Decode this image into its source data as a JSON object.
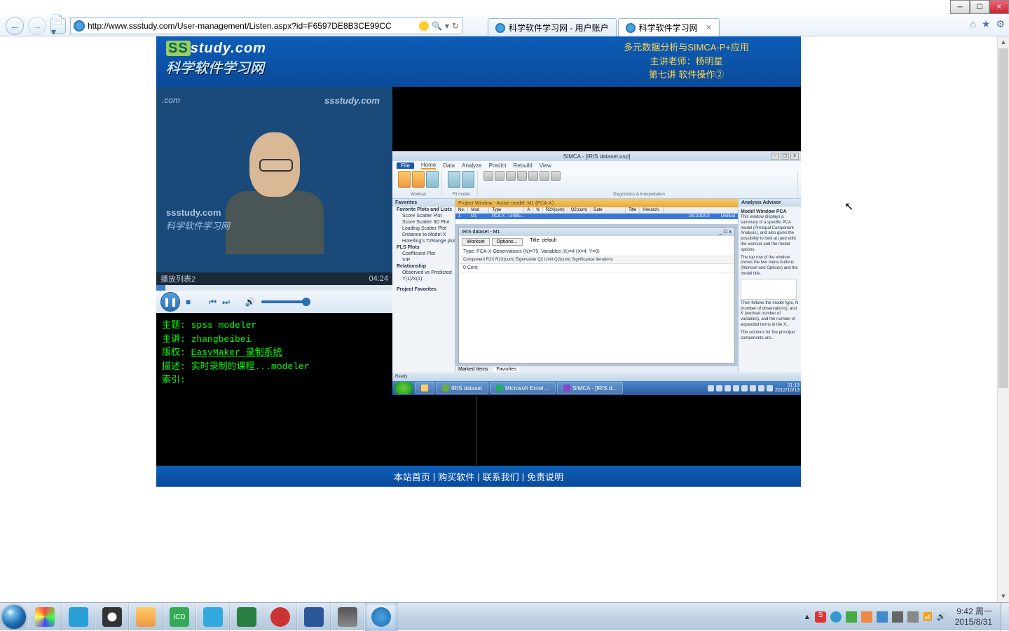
{
  "window": {
    "title": "科学软件学习网 - 用户账户"
  },
  "browser": {
    "url": "http://www.ssstudy.com/User-management/Listen.aspx?id=F6597DE8B3CE99CC",
    "tabs": [
      {
        "label": "科学软件学习网 - 用户账户",
        "active": false
      },
      {
        "label": "科学软件学习网",
        "active": true
      }
    ]
  },
  "header": {
    "logo_en": "study.com",
    "logo_cn": "科学软件学习网",
    "line1": "多元数据分析与SIMCA-P+应用",
    "line2": "主讲老师：杨明星",
    "line3": "第七讲 软件操作②"
  },
  "video": {
    "playlist_label": "播放列表2",
    "time": "04:24",
    "watermarks": {
      "w1": "ssstudy.com",
      "w2": "ssstudy.com",
      "w3": "科学软件学习网",
      "w4": ".com"
    }
  },
  "info": {
    "topic_label": "主题:",
    "topic": "spss modeler",
    "lecturer_label": "主讲:",
    "lecturer": "zhangbeibei",
    "copyright_label": "版权:",
    "copyright": "EasyMaker 录制系统",
    "desc_label": "描述:",
    "desc": "实时录制的课程...modeler",
    "index_label": "索引:"
  },
  "simca": {
    "title": "SIMCA - [IRIS dataset.usp]",
    "menu": [
      "File",
      "Home",
      "Data",
      "Analyze",
      "Predict",
      "Rebuild",
      "View"
    ],
    "ribbon_groups": [
      "Workset",
      "Fit model",
      "Diagnostics & Interpretation"
    ],
    "left_panel": {
      "title": "Favorites",
      "section1": "Favorite Plots and Lists",
      "items1": [
        "Score Scatter Plot",
        "Score Scatter 3D Plot",
        "Loading Scatter Plot",
        "Distance to Model X",
        "Hotelling's T2Range plot"
      ],
      "section2": "PLS Plots",
      "items2": [
        "Coefficient Plot",
        "VIP"
      ],
      "section3": "Relationship",
      "items3": [
        "Observed vs Predicted",
        "Y(1)/X(1)"
      ],
      "section4": "Project Favorites"
    },
    "project": {
      "header": "Project Window - Active model: M1 (PCA-X)",
      "cols": [
        "No.",
        "Mod",
        "Type",
        "A",
        "N",
        "R2X(cum)",
        "Q2(cum)",
        "Date",
        "Title",
        "Hierarch."
      ],
      "row": [
        "1",
        "M1",
        "PCA-X - Unfitte...",
        "",
        "",
        "",
        "",
        "2012/10/13",
        "Untitled",
        ""
      ]
    },
    "model": {
      "title": "IRIS dataset - M1",
      "tabs": [
        "Workset",
        "Options...",
        "Title: default"
      ],
      "info": "Type: PCA-X   Observations (N)=75, Variables (K)=4 (X=4, Y=0)",
      "cols": "Component R2X  R2X(cum) Eigenvalue Q2  Limit Q2(cum) Significance Iterations",
      "row0": "0                    Cent"
    },
    "advisor": {
      "title": "Analysis Advisor",
      "heading": "Model Window PCA",
      "body1": "This window displays a summary of a specific PCA model (Principal Component Analysis), and also gives the possibility to look at (and edit) the workset and the model options.",
      "body2": "The top row of the window shows the two menu buttons (Workset and Options) and the model title.",
      "body3": "Then follows the model type, N (number of observations), and K (workset number of variables), and the number of expanded terms in the X...",
      "body4": "The columns for the principal components are..."
    },
    "bottom_tabs": [
      "Marked Items",
      "Favorites"
    ],
    "status": "Ready",
    "inner_tasks": [
      "IRIS dataset",
      "Microsoft Excel ...",
      "SIMCA - [IRIS d..."
    ],
    "inner_time": "11:13",
    "inner_date": "2012/10/13"
  },
  "footer": {
    "links": [
      "本站首页",
      "购买软件",
      "联系我们",
      "免责说明"
    ]
  },
  "taskbar": {
    "time": "9:42",
    "day": "周一",
    "date": "2015/8/31"
  }
}
